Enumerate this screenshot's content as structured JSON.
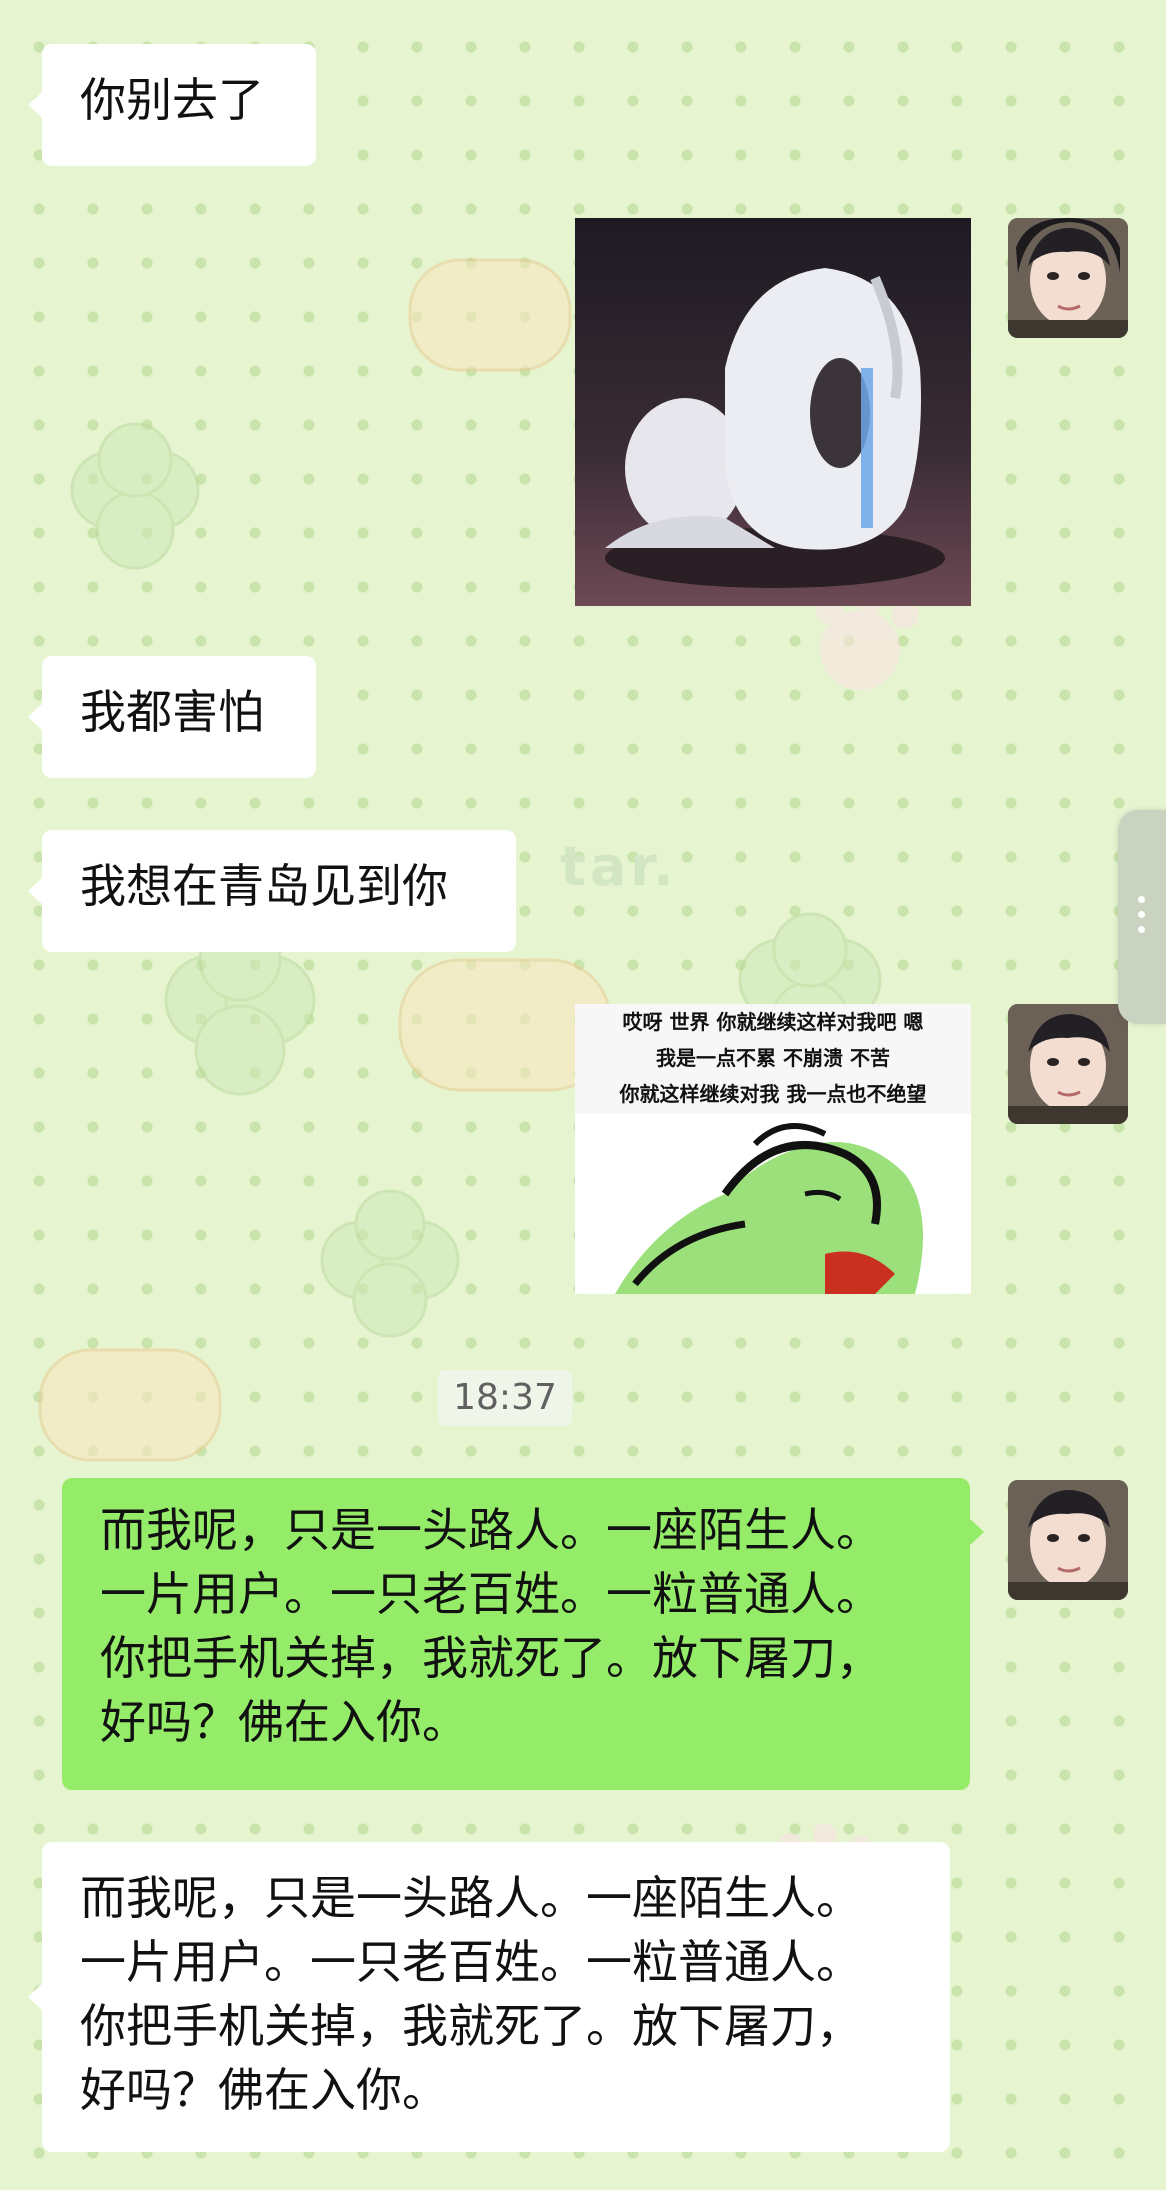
{
  "chat": {
    "messages": [
      {
        "type": "text",
        "side": "incoming",
        "text": "你别去了"
      },
      {
        "type": "sticker",
        "side": "outgoing",
        "sticker": "crying-white-bunny"
      },
      {
        "type": "text",
        "side": "incoming",
        "text": "我都害怕"
      },
      {
        "type": "text",
        "side": "incoming",
        "text": "我想在青岛见到你"
      },
      {
        "type": "sticker",
        "side": "outgoing",
        "sticker": "meme-text-sticker",
        "caption_lines": [
          "哎呀 世界 你就继续这样对我吧 嗯",
          "我是一点不累 不崩溃 不苦",
          "你就这样继续对我 我一点也不绝望"
        ]
      },
      {
        "type": "text",
        "side": "outgoing",
        "lines": [
          "而我呢，只是一头路人。一座陌生人。",
          "一片用户。一只老百姓。一粒普通人。",
          "你把手机关掉，我就死了。放下屠刀，",
          "好吗？佛在入你。"
        ]
      },
      {
        "type": "text",
        "side": "incoming",
        "lines": [
          "而我呢，只是一头路人。一座陌生人。",
          "一片用户。一只老百姓。一粒普通人。",
          "你把手机关掉，我就死了。放下屠刀，",
          "好吗？佛在入你。"
        ]
      }
    ],
    "timestamp": "18:37",
    "watermark": "tar.",
    "background_color": "#e6f4d0"
  },
  "colors": {
    "outgoing_bubble": "#95ec69",
    "incoming_bubble": "#ffffff",
    "timestamp_text": "#606060"
  },
  "icons": {
    "avatar": "user-avatar-photo",
    "side_handle": "more-vertical-dots-icon"
  }
}
